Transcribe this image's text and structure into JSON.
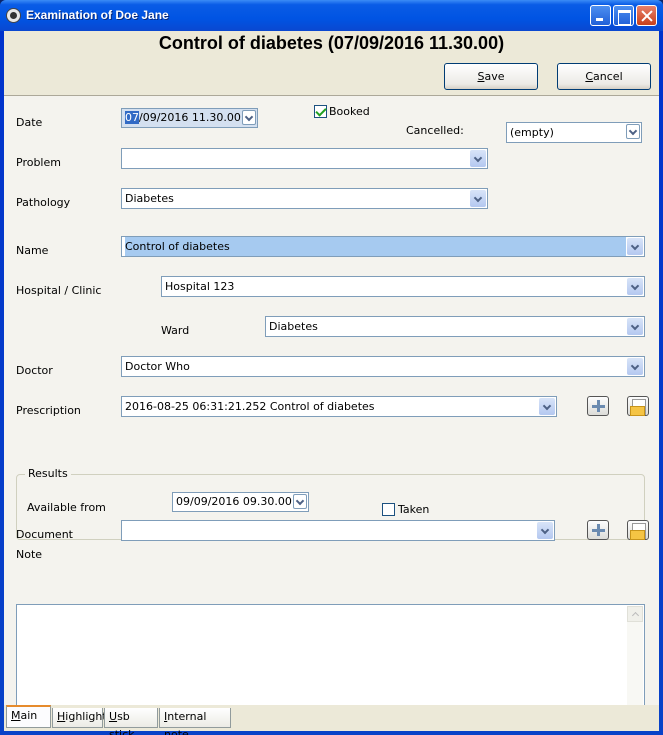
{
  "window": {
    "title": "Examination of Doe Jane",
    "controls": [
      "minimize",
      "maximize",
      "close"
    ]
  },
  "header": {
    "title": "Control of diabetes (07/09/2016 11.30.00)"
  },
  "toolbar": {
    "save_label": "Save",
    "save_mnemonic": "S",
    "save_rest": "ave",
    "cancel_mnemonic": "C",
    "cancel_rest": "ancel"
  },
  "form": {
    "date": {
      "label": "Date",
      "value_caret": "07",
      "value_rest": "/09/2016   11.30.00"
    },
    "booked": {
      "label": "Booked",
      "checked": true
    },
    "cancelled": {
      "label": "Cancelled:",
      "value": "(empty)"
    },
    "problem": {
      "label": "Problem",
      "value": ""
    },
    "pathology": {
      "label": "Pathology",
      "value": "Diabetes"
    },
    "name": {
      "label": "Name",
      "value": "Control of diabetes"
    },
    "hospital": {
      "label": "Hospital / Clinic",
      "value": "Hospital 123"
    },
    "ward": {
      "label": "Ward",
      "value": "Diabetes"
    },
    "doctor": {
      "label": "Doctor",
      "value": "Doctor Who"
    },
    "prescription": {
      "label": "Prescription",
      "value": "2016-08-25 06:31:21.252  Control of diabetes"
    },
    "results": {
      "title": "Results",
      "available_from": {
        "label": "Available from",
        "value": "09/09/2016   09.30.00"
      },
      "taken": {
        "label": "Taken",
        "checked": false
      }
    },
    "document": {
      "label": "Document",
      "value": ""
    },
    "note": {
      "label": "Note",
      "value": ""
    }
  },
  "tabs": [
    {
      "mnemonic": "M",
      "rest": "ain",
      "active": true
    },
    {
      "mnemonic": "H",
      "rest": "ighlight",
      "active": false
    },
    {
      "mnemonic": "U",
      "rest": "sb stick",
      "active": false
    },
    {
      "mnemonic": "I",
      "rest": "nternal note",
      "active": false
    }
  ]
}
